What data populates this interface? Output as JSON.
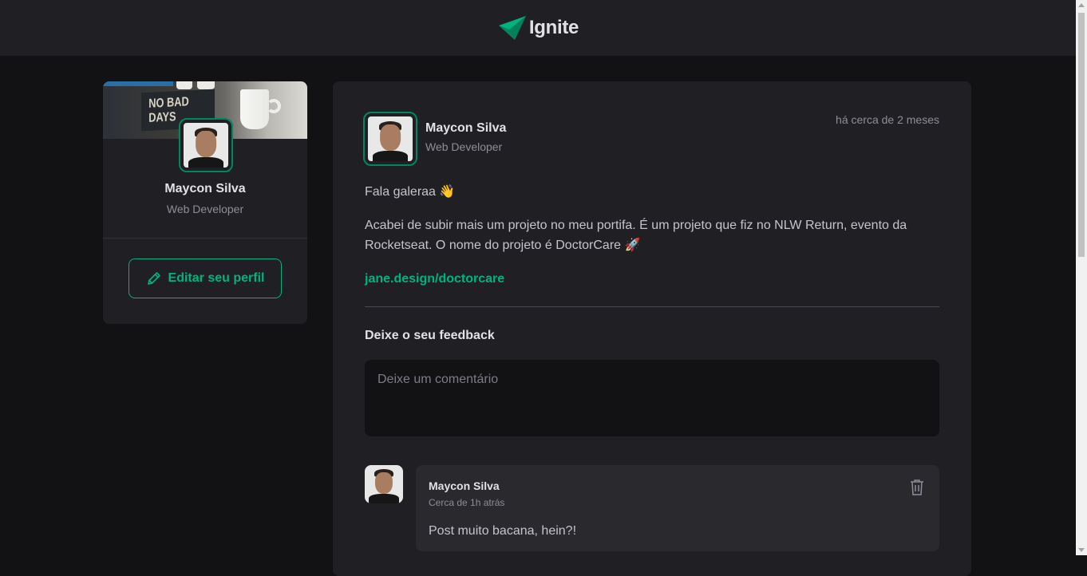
{
  "header": {
    "logo_text": "Ignite",
    "logo_icon": "ignite-logo-icon"
  },
  "sidebar": {
    "cover_text": "NO BAD DAYS",
    "name": "Maycon Silva",
    "role": "Web Developer",
    "edit_button_label": "Editar seu perfil",
    "edit_icon": "pencil-icon"
  },
  "post": {
    "author_name": "Maycon Silva",
    "author_role": "Web Developer",
    "published": "há cerca de 2 meses",
    "paragraph_1": "Fala galeraa 👋",
    "paragraph_2": "Acabei de subir mais um projeto no meu portifa. É um projeto que fiz no NLW Return, evento da Rocketseat. O nome do projeto é DoctorCare 🚀",
    "link": "jane.design/doctorcare",
    "feedback_title": "Deixe o seu feedback",
    "comment_placeholder": "Deixe um comentário"
  },
  "comments": [
    {
      "author": "Maycon Silva",
      "time": "Cerca de 1h atrás",
      "text": "Post muito bacana, hein?!",
      "delete_icon": "trash-icon"
    }
  ],
  "colors": {
    "accent": "#00b37e",
    "accent_dark": "#00875f",
    "background": "#121214",
    "card": "#202024"
  }
}
